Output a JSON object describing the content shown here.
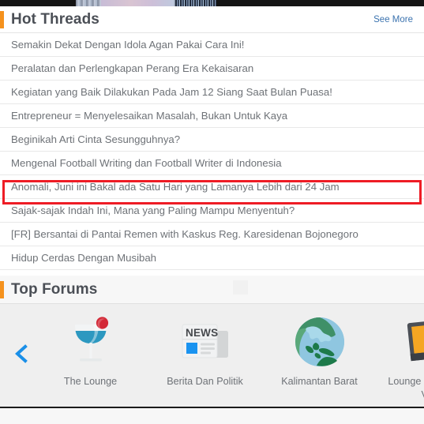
{
  "banner": {
    "name": "cropped-top-banner"
  },
  "hot_threads": {
    "title": "Hot Threads",
    "see_more_label": "See More",
    "accent_color": "#f5921e",
    "link_color": "#3b73af",
    "items": [
      {
        "title": "Semakin Dekat Dengan Idola Agan Pakai Cara Ini!",
        "highlighted": false
      },
      {
        "title": "Peralatan dan Perlengkapan Perang Era Kekaisaran",
        "highlighted": false
      },
      {
        "title": "Kegiatan yang Baik Dilakukan Pada Jam 12 Siang Saat Bulan Puasa!",
        "highlighted": false
      },
      {
        "title": "Entrepreneur = Menyelesaikan Masalah, Bukan Untuk Kaya",
        "highlighted": false
      },
      {
        "title": "Beginikah Arti Cinta Sesungguhnya?",
        "highlighted": false
      },
      {
        "title": "Mengenal Football Writing dan Football Writer di Indonesia",
        "highlighted": false
      },
      {
        "title": "Anomali, Juni ini Bakal ada Satu Hari yang Lamanya Lebih dari 24 Jam",
        "highlighted": true
      },
      {
        "title": "Sajak-sajak Indah Ini, Mana yang Paling Mampu Menyentuh?",
        "highlighted": false
      },
      {
        "title": "[FR] Bersantai di Pantai Remen with Kaskus Reg. Karesidenan Bojonegoro",
        "highlighted": false
      },
      {
        "title": "Hidup Cerdas Dengan Musibah",
        "highlighted": false
      }
    ],
    "highlight_color": "#ee1c25"
  },
  "top_forums": {
    "title": "Top Forums",
    "prev_arrow": "chevron-left",
    "items": [
      {
        "label": "The Lounge",
        "icon": "cocktail-glass-icon"
      },
      {
        "label": "Berita Dan Politik",
        "icon": "newspaper-icon"
      },
      {
        "label": "Kalimantan Barat",
        "icon": "globe-icon"
      },
      {
        "label": "Lounge Pictures And\nVideo",
        "icon": "monitor-cocktail-icon"
      }
    ]
  }
}
